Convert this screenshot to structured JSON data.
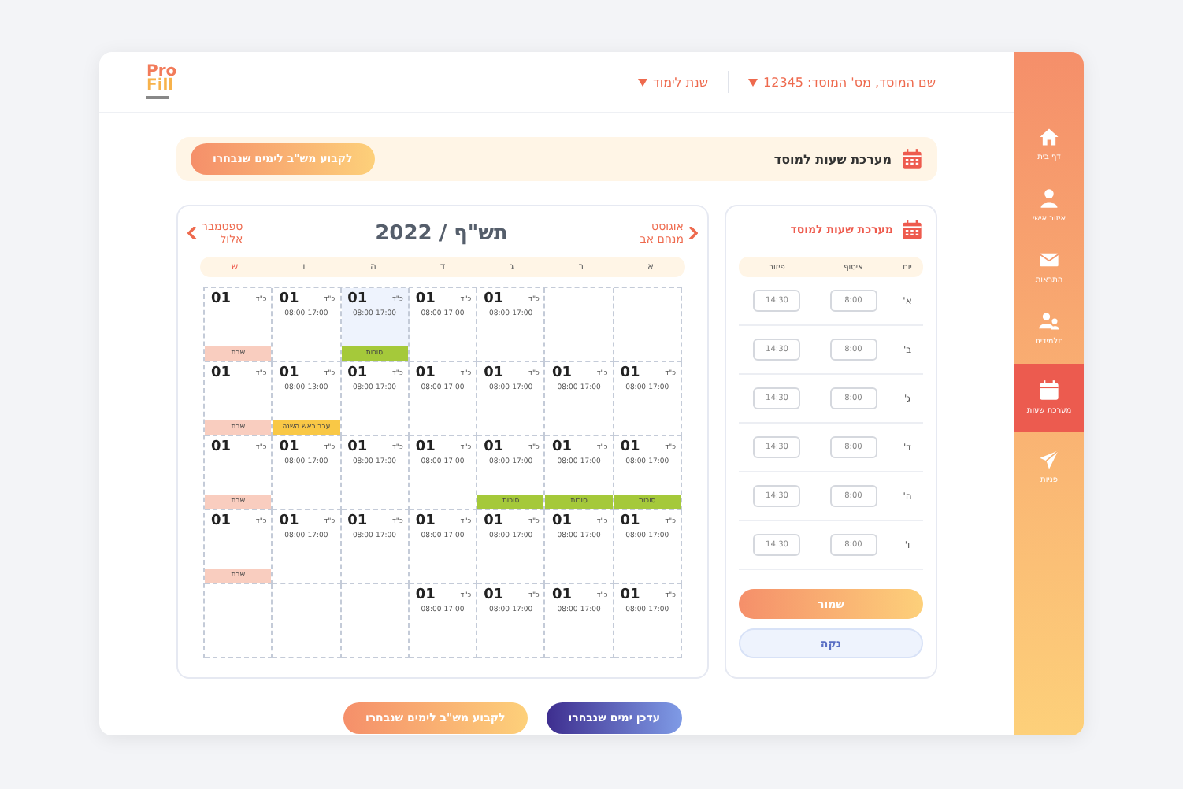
{
  "header": {
    "logo": {
      "top": "Pro",
      "bottom": "Fill"
    },
    "dropdowns": [
      {
        "label": "שם המוסד, מס' המוסד: 12345"
      },
      {
        "label": "שנת לימוד"
      }
    ]
  },
  "sidebar": {
    "items": [
      {
        "label": "דף בית",
        "kind": "home",
        "selected": false
      },
      {
        "label": "איזור אישי",
        "kind": "user",
        "selected": false
      },
      {
        "label": "התראות",
        "kind": "mail",
        "selected": false
      },
      {
        "label": "תלמידים",
        "kind": "users",
        "selected": false
      },
      {
        "label": "מערכת שעות",
        "kind": "calendar",
        "selected": true
      },
      {
        "label": "פניות",
        "kind": "send",
        "selected": false
      }
    ]
  },
  "banner": {
    "title": "מערכת שעות למוסד",
    "button": "לקבוע מש\"ב לימים שנבחרו"
  },
  "schedule_panel": {
    "title": "מערכת שעות למוסד",
    "columns": [
      "יום",
      "איסוף",
      "פיזור"
    ],
    "rows": [
      {
        "day": "א'",
        "pickup": "8:00",
        "dropoff": "14:30"
      },
      {
        "day": "ב'",
        "pickup": "8:00",
        "dropoff": "14:30"
      },
      {
        "day": "ג'",
        "pickup": "8:00",
        "dropoff": "14:30"
      },
      {
        "day": "ד'",
        "pickup": "8:00",
        "dropoff": "14:30"
      },
      {
        "day": "ה'",
        "pickup": "8:00",
        "dropoff": "14:30"
      },
      {
        "day": "ו'",
        "pickup": "8:00",
        "dropoff": "14:30"
      }
    ],
    "save_button": "שמור",
    "clear_button": "נקה"
  },
  "calendar": {
    "prev": {
      "month": "אוגוסט",
      "hebrew_month": "מנחם אב"
    },
    "title": "תש\"ף / 2022",
    "next": {
      "month": "ספטמבר",
      "hebrew_month": "אלול"
    },
    "weekdays": [
      "א",
      "ב",
      "ג",
      "ד",
      "ה",
      "ו",
      "ש"
    ],
    "weeks": [
      [
        {
          "kind": "empty"
        },
        {
          "kind": "empty"
        },
        {
          "kind": "day",
          "date": "01",
          "hebrew_date": "כ\"ד",
          "hours": "08:00-17:00",
          "selected": false
        },
        {
          "kind": "day",
          "date": "01",
          "hebrew_date": "כ\"ד",
          "hours": "08:00-17:00",
          "selected": false
        },
        {
          "kind": "day",
          "date": "01",
          "hebrew_date": "כ\"ד",
          "hours": "08:00-17:00",
          "selected": true,
          "event": {
            "label": "סוכות",
            "color": "#a5c93a"
          }
        },
        {
          "kind": "day",
          "date": "01",
          "hebrew_date": "כ\"ד",
          "hours": "08:00-17:00",
          "selected": false
        },
        {
          "kind": "day",
          "date": "01",
          "hebrew_date": "כ\"ד",
          "selected": false,
          "event": {
            "label": "שבת",
            "color": "#f9cdbf"
          }
        }
      ],
      [
        {
          "kind": "day",
          "date": "01",
          "hebrew_date": "כ\"ד",
          "hours": "08:00-17:00",
          "selected": false
        },
        {
          "kind": "day",
          "date": "01",
          "hebrew_date": "כ\"ד",
          "hours": "08:00-17:00",
          "selected": false
        },
        {
          "kind": "day",
          "date": "01",
          "hebrew_date": "כ\"ד",
          "hours": "08:00-17:00",
          "selected": false
        },
        {
          "kind": "day",
          "date": "01",
          "hebrew_date": "כ\"ד",
          "hours": "08:00-17:00",
          "selected": false
        },
        {
          "kind": "day",
          "date": "01",
          "hebrew_date": "כ\"ד",
          "hours": "08:00-17:00",
          "selected": false
        },
        {
          "kind": "day",
          "date": "01",
          "hebrew_date": "כ\"ד",
          "hours": "08:00-13:00",
          "selected": false,
          "event": {
            "label": "ערב ראש השנה",
            "color": "#f9c846"
          }
        },
        {
          "kind": "day",
          "date": "01",
          "hebrew_date": "כ\"ד",
          "selected": false,
          "event": {
            "label": "שבת",
            "color": "#f9cdbf"
          }
        }
      ],
      [
        {
          "kind": "day",
          "date": "01",
          "hebrew_date": "כ\"ד",
          "hours": "08:00-17:00",
          "selected": false,
          "event": {
            "label": "סוכות",
            "color": "#a5c93a"
          }
        },
        {
          "kind": "day",
          "date": "01",
          "hebrew_date": "כ\"ד",
          "hours": "08:00-17:00",
          "selected": false,
          "event": {
            "label": "סוכות",
            "color": "#a5c93a"
          }
        },
        {
          "kind": "day",
          "date": "01",
          "hebrew_date": "כ\"ד",
          "hours": "08:00-17:00",
          "selected": false,
          "event": {
            "label": "סוכות",
            "color": "#a5c93a"
          }
        },
        {
          "kind": "day",
          "date": "01",
          "hebrew_date": "כ\"ד",
          "hours": "08:00-17:00",
          "selected": false
        },
        {
          "kind": "day",
          "date": "01",
          "hebrew_date": "כ\"ד",
          "hours": "08:00-17:00",
          "selected": false
        },
        {
          "kind": "day",
          "date": "01",
          "hebrew_date": "כ\"ד",
          "hours": "08:00-17:00",
          "selected": false
        },
        {
          "kind": "day",
          "date": "01",
          "hebrew_date": "כ\"ד",
          "selected": false,
          "event": {
            "label": "שבת",
            "color": "#f9cdbf"
          }
        }
      ],
      [
        {
          "kind": "day",
          "date": "01",
          "hebrew_date": "כ\"ד",
          "hours": "08:00-17:00",
          "selected": false
        },
        {
          "kind": "day",
          "date": "01",
          "hebrew_date": "כ\"ד",
          "hours": "08:00-17:00",
          "selected": false
        },
        {
          "kind": "day",
          "date": "01",
          "hebrew_date": "כ\"ד",
          "hours": "08:00-17:00",
          "selected": false
        },
        {
          "kind": "day",
          "date": "01",
          "hebrew_date": "כ\"ד",
          "hours": "08:00-17:00",
          "selected": false
        },
        {
          "kind": "day",
          "date": "01",
          "hebrew_date": "כ\"ד",
          "hours": "08:00-17:00",
          "selected": false
        },
        {
          "kind": "day",
          "date": "01",
          "hebrew_date": "כ\"ד",
          "hours": "08:00-17:00",
          "selected": false
        },
        {
          "kind": "day",
          "date": "01",
          "hebrew_date": "כ\"ד",
          "selected": false,
          "event": {
            "label": "שבת",
            "color": "#f9cdbf"
          }
        }
      ],
      [
        {
          "kind": "day",
          "date": "01",
          "hebrew_date": "כ\"ד",
          "hours": "08:00-17:00",
          "selected": false
        },
        {
          "kind": "day",
          "date": "01",
          "hebrew_date": "כ\"ד",
          "hours": "08:00-17:00",
          "selected": false
        },
        {
          "kind": "day",
          "date": "01",
          "hebrew_date": "כ\"ד",
          "hours": "08:00-17:00",
          "selected": false
        },
        {
          "kind": "day",
          "date": "01",
          "hebrew_date": "כ\"ד",
          "hours": "08:00-17:00",
          "selected": false
        },
        {
          "kind": "empty"
        },
        {
          "kind": "empty"
        },
        {
          "kind": "empty"
        }
      ]
    ]
  },
  "footer_buttons": [
    {
      "label": "עדכן ימים שנבחרו",
      "kind": "primary"
    },
    {
      "label": "לקבוע מש\"ב לימים שנבחרו",
      "kind": "accent"
    }
  ]
}
